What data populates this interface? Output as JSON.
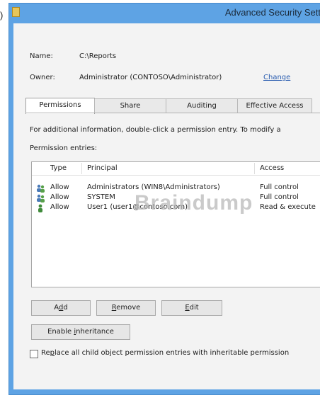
{
  "frame_label": ")",
  "window": {
    "title": "Advanced Security Sett",
    "name_label": "Name:",
    "name_value": "C:\\Reports",
    "owner_label": "Owner:",
    "owner_value": "Administrator (CONTOSO\\Administrator)",
    "owner_change_link": "Change"
  },
  "tabs": [
    {
      "label": "Permissions",
      "active": true
    },
    {
      "label": "Share",
      "active": false
    },
    {
      "label": "Auditing",
      "active": false
    },
    {
      "label": "Effective Access",
      "active": false
    }
  ],
  "info_text": "For additional information, double-click a permission entry. To modify a",
  "entries_label": "Permission entries:",
  "columns": {
    "type": "Type",
    "principal": "Principal",
    "access": "Access"
  },
  "entries": [
    {
      "icon": "group-users-icon",
      "type": "Allow",
      "principal": "Administrators (WIN8\\Administrators)",
      "access": "Full control"
    },
    {
      "icon": "group-users-icon",
      "type": "Allow",
      "principal": "SYSTEM",
      "access": "Full control"
    },
    {
      "icon": "user-icon",
      "type": "Allow",
      "principal": "User1 (user1@contoso.com)",
      "access": "Read & execute"
    }
  ],
  "watermark": "Braindump",
  "buttons": {
    "add_prefix": "A",
    "add_mnemonic": "d",
    "add_suffix": "d",
    "remove_mnemonic": "R",
    "remove_suffix": "emove",
    "edit_mnemonic": "E",
    "edit_suffix": "dit",
    "inherit_prefix": "Enable ",
    "inherit_mnemonic": "i",
    "inherit_suffix": "nheritance"
  },
  "replace_checkbox": {
    "checked": false,
    "prefix": "Re",
    "mnemonic": "p",
    "suffix": "lace all child object permission entries with inheritable permission"
  },
  "colors": {
    "title_bar": "#5ea3e4",
    "client": "#f3f3f3",
    "link": "#2a5db0"
  }
}
